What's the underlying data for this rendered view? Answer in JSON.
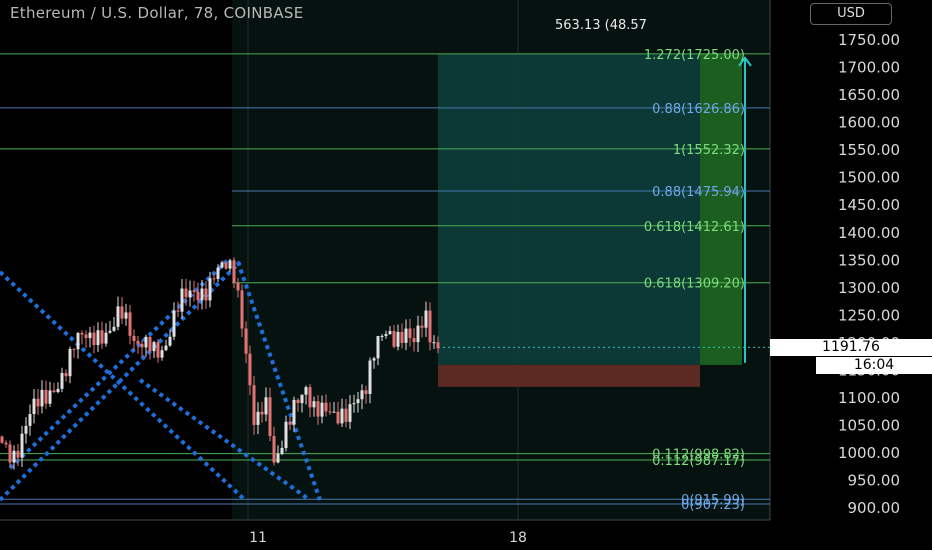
{
  "header": {
    "title": "Ethereum / U.S. Dollar, 78, COINBASE",
    "currency_button": "USD",
    "readout": "563.13 (48.57"
  },
  "price_tag": "1191.76",
  "timer_tag": "16:04",
  "colors": {
    "bg": "#000000",
    "green_line": "#4caf50",
    "blue_line": "#4a78b0",
    "teal_zone": "#0d3d3a",
    "red_zone": "#5c2a22",
    "green_zone": "#1b5e20",
    "arrow": "#26c6c6",
    "candle_up": "#e0e0e0",
    "candle_down": "#e57373",
    "channel": "#1e6fd9"
  },
  "chart_data": {
    "type": "candlestick",
    "y_axis": {
      "ticks": [
        900,
        950,
        1000,
        1050,
        1100,
        1150,
        1200,
        1250,
        1300,
        1350,
        1400,
        1450,
        1500,
        1550,
        1600,
        1650,
        1700,
        1750
      ],
      "range": [
        875,
        1800
      ]
    },
    "x_axis": {
      "ticks": [
        "11",
        "18"
      ]
    },
    "fib_levels": [
      {
        "label": "1.272(1725.00)",
        "price": 1725.0,
        "color": "green"
      },
      {
        "label": "0.88(1626.86)",
        "price": 1626.86,
        "color": "blue"
      },
      {
        "label": "1(1552.32)",
        "price": 1552.32,
        "color": "green"
      },
      {
        "label": "0.88(1475.94)",
        "price": 1475.94,
        "color": "blue"
      },
      {
        "label": "0.618(1412.61)",
        "price": 1412.61,
        "color": "green"
      },
      {
        "label": "0.618(1309.20)",
        "price": 1309.2,
        "color": "green"
      },
      {
        "label": "0.112(998.82)",
        "price": 998.82,
        "color": "green"
      },
      {
        "label": "0.112(987.17)",
        "price": 987.17,
        "color": "green"
      },
      {
        "label": "0(915.99)",
        "price": 915.99,
        "color": "blue"
      },
      {
        "label": "0(907.23)",
        "price": 907.23,
        "color": "blue"
      }
    ],
    "position": {
      "entry": 1160,
      "target": 1725,
      "stop": 1120
    },
    "last_price": 1191.76
  }
}
